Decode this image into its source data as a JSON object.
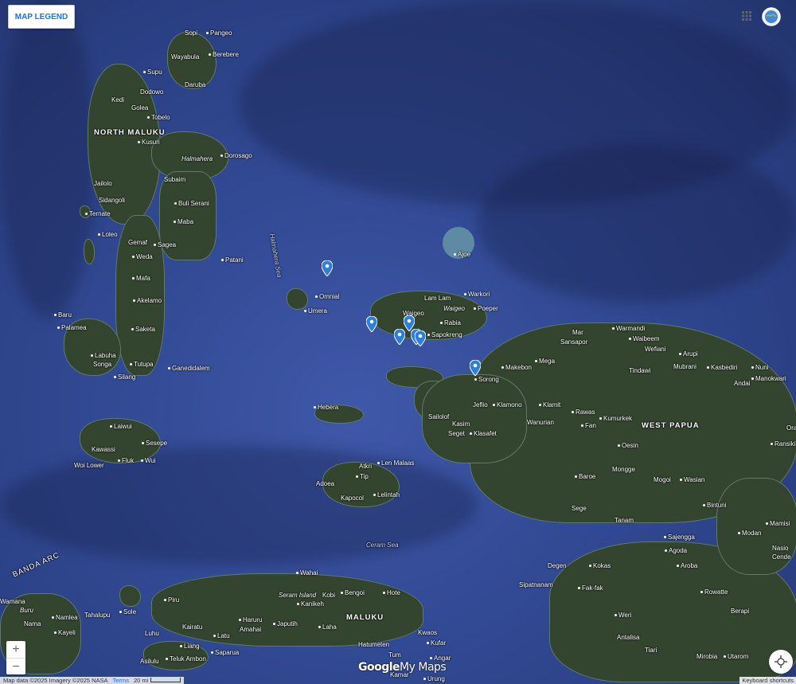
{
  "controls": {
    "legend_button": "MAP LEGEND",
    "zoom_in": "+",
    "zoom_out": "−"
  },
  "branding": {
    "logo_google": "Google",
    "logo_mymaps": "My Maps"
  },
  "footer": {
    "attribution": "Map data ©2025 Imagery ©2025 NASA",
    "terms": "Terms",
    "scale_label": "20 mi",
    "keyboard_shortcuts": "Keyboard shortcuts"
  },
  "regions": {
    "north_maluku": "NORTH MALUKU",
    "west_papua": "WEST PAPUA",
    "maluku": "MALUKU",
    "banda_arc": "BANDA ARC"
  },
  "seas": {
    "halmahera_sea": "Halmahera Sea",
    "ceram_sea": "Ceram Sea"
  },
  "islands": {
    "halmahera": "Halmahera",
    "waigeo": "Waigeo",
    "seram": "Seram Island",
    "buru": "Buru"
  },
  "places": {
    "sopi": "Sopi",
    "pangeo": "Pangeo",
    "wayabula": "Wayabula",
    "berebere": "Berebere",
    "supu": "Supu",
    "dodowo": "Dodowo",
    "daruba": "Daruba",
    "kedi": "Kedi",
    "golea": "Golea",
    "tobelo": "Tobelo",
    "kusuri": "Kusuri",
    "dorosago": "Dorosago",
    "subaim": "Subaim",
    "jailolo": "Jailolo",
    "sidangoli": "Sidangoli",
    "ternate": "Ternate",
    "buli_serani": "Buli Serani",
    "maba": "Maba",
    "loleo": "Loleo",
    "gemaf": "Gemaf",
    "sagea": "Sagea",
    "weda": "Weda",
    "patani": "Patani",
    "mafa": "Mafa",
    "akelamo": "Akelamo",
    "baru": "Baru",
    "palamea": "Palamea",
    "saketa": "Saketa",
    "labuha": "Labuha",
    "songa": "Songa",
    "tutupa": "Tutupa",
    "silang": "Silang",
    "ganedidalem": "Ganedidalem",
    "laiwui": "Laiwui",
    "kawassi": "Kawassi",
    "sesepe": "Sesepe",
    "fluk": "Fluk",
    "wui": "Wui",
    "woi_lower": "Woi Lower",
    "omnial": "Omnial",
    "umera": "Umera",
    "lam_lam": "Lam Lam",
    "warkori": "Warkori",
    "waigeo": "Waigeo",
    "poeper": "Poeper",
    "rabia": "Rabia",
    "sapokreng": "Sapokreng",
    "ajoe": "Ajoe",
    "mar": "Mar",
    "warmandi": "Warmandi",
    "sansapor": "Sansapor",
    "waibeem": "Waibeem",
    "wefiani": "Wefiani",
    "arupi": "Arupi",
    "mega": "Mega",
    "makebon": "Makebon",
    "tindawi": "Tindawi",
    "mubrani": "Mubrani",
    "kasbediri": "Kasbediri",
    "nuni": "Nuni",
    "andai": "Andai",
    "manokwari": "Manokwari",
    "sorong": "Sorong",
    "jeflio": "Jeflio",
    "klamono": "Klamono",
    "klamit": "Klamit",
    "sailolof": "Sailolof",
    "kasim": "Kasim",
    "rawas": "Rawas",
    "wanurian": "Wanurian",
    "kumurkek": "Kumurkek",
    "fan": "Fan",
    "seget": "Seget",
    "klasafet": "Klasafet",
    "oesin": "Oesin",
    "ransiki": "Ransiki",
    "hebera": "Hebera",
    "atkri": "Atkri",
    "len_malaas": "Len Malaas",
    "tip": "Tip",
    "adoea": "Adoea",
    "kapocol": "Kapocol",
    "lelintah": "Lelintah",
    "baroe": "Baroe",
    "mongge": "Mongge",
    "mogoi": "Mogoi",
    "wasian": "Wasian",
    "bintuni": "Bintuni",
    "sege": "Sege",
    "tanam": "Tanam",
    "modan": "Modan",
    "mamisi": "Mamisi",
    "sajengga": "Sajengga",
    "agoda": "Agoda",
    "degen": "Degen",
    "kokas": "Kokas",
    "aroba": "Aroba",
    "sipatnanam": "Sipatnanam",
    "fak_fak": "Fak-fak",
    "rowatte": "Rowatte",
    "weri": "Weri",
    "berapi": "Berapi",
    "antalisa": "Antalisa",
    "tiari": "Tiari",
    "mirobia": "Mirobia",
    "utarom": "Utarom",
    "wahai": "Wahai",
    "kobi": "Kobi",
    "bengoi": "Bengoi",
    "hote": "Hote",
    "piru": "Piru",
    "kanikeh": "Kanikeh",
    "wamana": "Wamana",
    "namlea": "Namlea",
    "tahalupu": "Tahalupu",
    "sole": "Sole",
    "nama": "Nama",
    "kayeli": "Kayeli",
    "kairatu": "Kairatu",
    "haruru": "Haruru",
    "japutih": "Japutih",
    "amahai": "Amahai",
    "laha": "Laha",
    "luhu": "Luhu",
    "latu": "Latu",
    "liang": "Liang",
    "saparua": "Saparua",
    "hatumeten": "Hatumeten",
    "kwaos": "Kwaos",
    "kufar": "Kufar",
    "tum": "Tum",
    "angar": "Angar",
    "asilulu": "Asilulu",
    "teluk_ambon": "Teluk Ambon",
    "urung": "Urung",
    "kamar": "Kamar",
    "naso": "Nasio",
    "cende": "Cende",
    "ora": "Ora"
  },
  "colors": {
    "ocean": "#3f58a8",
    "land": "#34452f",
    "pin": "#2f7fd6",
    "accent": "#1a73e8"
  },
  "icons": {
    "marker": "map-marker-icon",
    "apps": "apps-grid-icon",
    "account": "globe-account-icon",
    "locate": "locate-me-icon"
  }
}
